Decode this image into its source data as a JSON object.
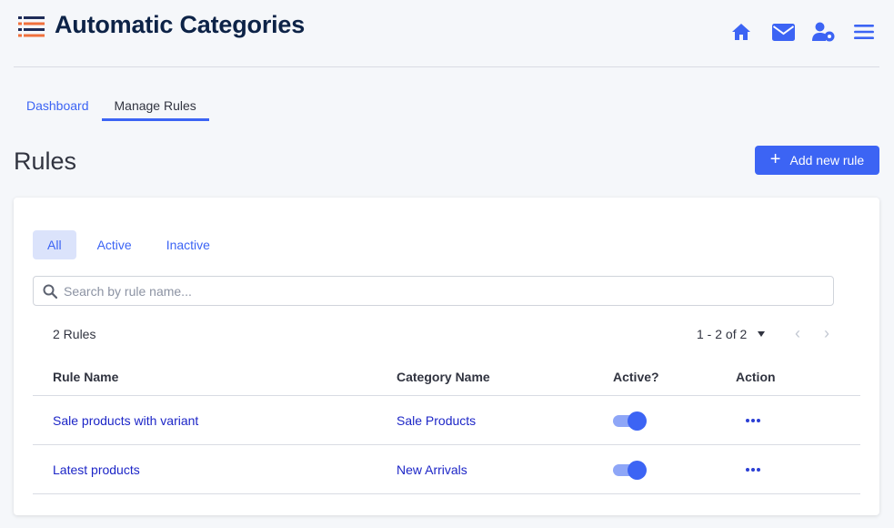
{
  "app": {
    "title": "Automatic Categories",
    "logo_icon": "list-icon"
  },
  "header_icons": [
    {
      "name": "home-icon"
    },
    {
      "name": "mail-icon"
    },
    {
      "name": "user-settings-icon"
    },
    {
      "name": "menu-icon"
    }
  ],
  "nav": {
    "tabs": [
      {
        "label": "Dashboard",
        "active": false
      },
      {
        "label": "Manage Rules",
        "active": true
      }
    ]
  },
  "section": {
    "title": "Rules",
    "add_button": "Add new rule"
  },
  "filters": {
    "tabs": [
      {
        "label": "All",
        "selected": true
      },
      {
        "label": "Active",
        "selected": false
      },
      {
        "label": "Inactive",
        "selected": false
      }
    ]
  },
  "search": {
    "placeholder": "Search by rule name...",
    "value": ""
  },
  "summary": {
    "count": "2 Rules",
    "pagination": "1 - 2 of 2"
  },
  "table": {
    "columns": [
      "Rule Name",
      "Category Name",
      "Active?",
      "Action"
    ],
    "rows": [
      {
        "rule_name": "Sale products with variant",
        "category": "Sale Products",
        "active": true
      },
      {
        "rule_name": "Latest products",
        "category": "New Arrivals",
        "active": true
      }
    ]
  },
  "colors": {
    "accent": "#3c64f4",
    "title": "#0d2347",
    "link": "#1d26c7",
    "selected_tab_bg": "#dbe3fb",
    "logo_orange": "#f0703c",
    "logo_navy": "#1e2c58"
  }
}
